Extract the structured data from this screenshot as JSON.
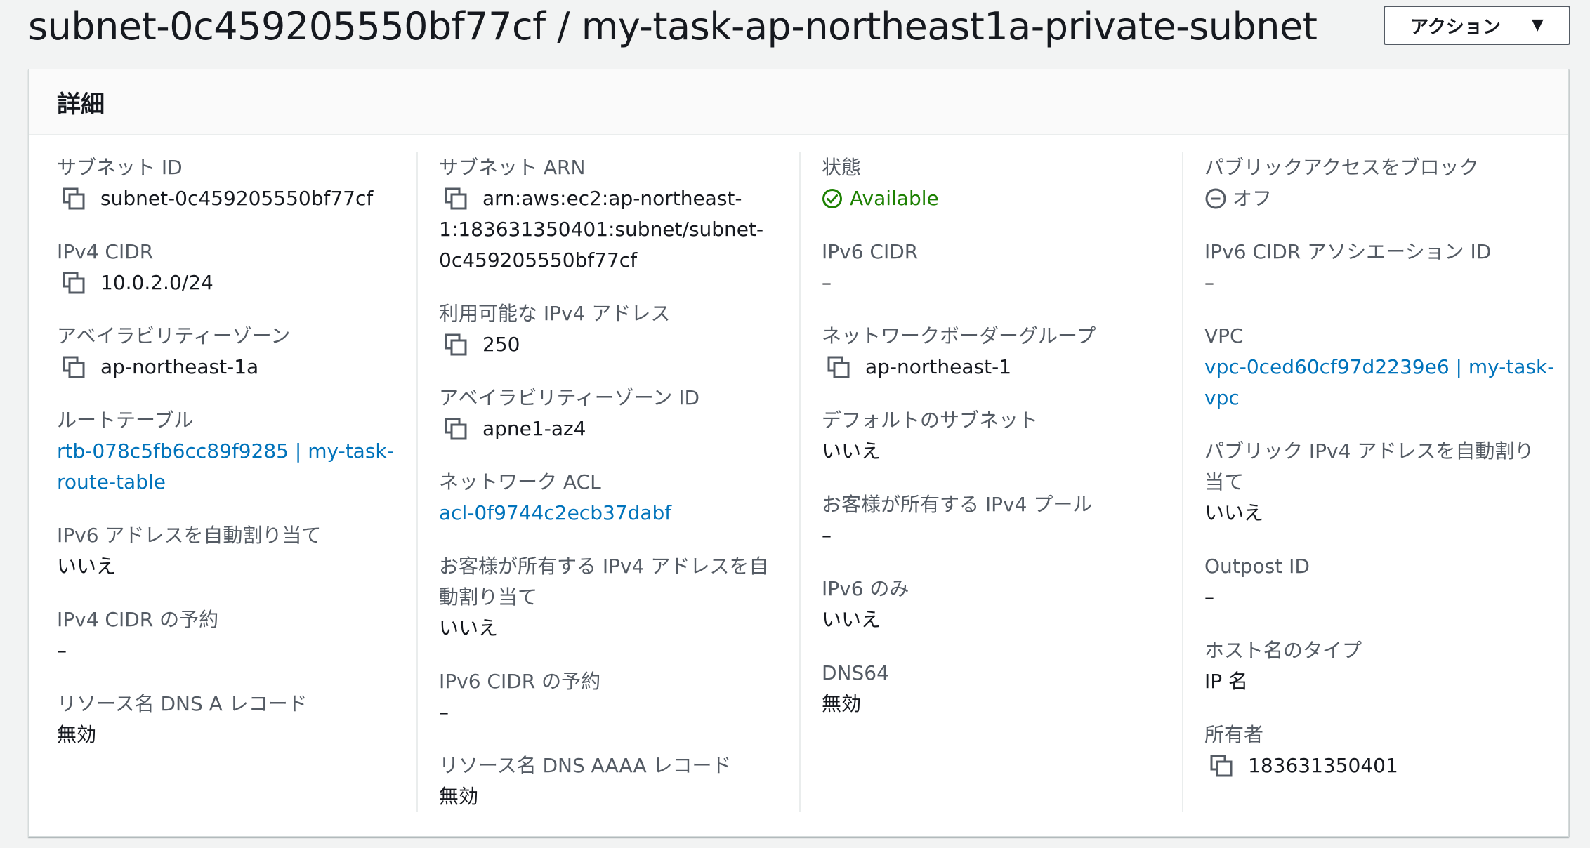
{
  "header": {
    "title": "subnet-0c459205550bf77cf / my-task-ap-northeast1a-private-subnet",
    "action_button": "アクション",
    "action_caret_icon": "caret-down-icon"
  },
  "panel": {
    "title": "詳細"
  },
  "col1": {
    "subnet_id": {
      "label": "サブネット ID",
      "value": "subnet-0c459205550bf77cf"
    },
    "ipv4_cidr": {
      "label": "IPv4 CIDR",
      "value": "10.0.2.0/24"
    },
    "az": {
      "label": "アベイラビリティーゾーン",
      "value": "ap-northeast-1a"
    },
    "route_table": {
      "label": "ルートテーブル",
      "line1": "rtb-078c5fb6cc89f9285 | my-task-",
      "line2": "route-table"
    },
    "ipv6_auto": {
      "label": "IPv6 アドレスを自動割り当て",
      "value": "いいえ"
    },
    "ipv4_reservation": {
      "label": "IPv4 CIDR の予約",
      "value": "–"
    },
    "dns_a": {
      "label": "リソース名 DNS A レコード",
      "value": "無効"
    }
  },
  "col2": {
    "subnet_arn": {
      "label": "サブネット ARN",
      "line1": "arn:aws:ec2:ap-northeast-",
      "line2": "1:183631350401:subnet/subnet-",
      "line3": "0c459205550bf77cf"
    },
    "available_ipv4": {
      "label": "利用可能な IPv4 アドレス",
      "value": "250"
    },
    "az_id": {
      "label": "アベイラビリティーゾーン ID",
      "value": "apne1-az4"
    },
    "network_acl": {
      "label": "ネットワーク ACL",
      "value": "acl-0f9744c2ecb37dabf"
    },
    "customer_owned_auto": {
      "label_line1": "お客様が所有する IPv4 アドレスを自",
      "label_line2": "動割り当て",
      "value": "いいえ"
    },
    "ipv6_reservation": {
      "label": "IPv6 CIDR の予約",
      "value": "–"
    },
    "dns_aaaa": {
      "label": "リソース名 DNS AAAA レコード",
      "value": "無効"
    }
  },
  "col3": {
    "state": {
      "label": "状態",
      "value": "Available",
      "color": "#1d8102"
    },
    "ipv6_cidr": {
      "label": "IPv6 CIDR",
      "value": "–"
    },
    "border_group": {
      "label": "ネットワークボーダーグループ",
      "value": "ap-northeast-1"
    },
    "default_subnet": {
      "label": "デフォルトのサブネット",
      "value": "いいえ"
    },
    "customer_pool": {
      "label": "お客様が所有する IPv4 プール",
      "value": "–"
    },
    "ipv6_only": {
      "label": "IPv6 のみ",
      "value": "いいえ"
    },
    "dns64": {
      "label": "DNS64",
      "value": "無効"
    }
  },
  "col4": {
    "block_public": {
      "label": "パブリックアクセスをブロック",
      "value": "オフ"
    },
    "ipv6_assoc": {
      "label": "IPv6 CIDR アソシエーション ID",
      "value": "–"
    },
    "vpc": {
      "label": "VPC",
      "line1": "vpc-0ced60cf97d2239e6 | my-task-",
      "line2": "vpc"
    },
    "public_ipv4_auto": {
      "label_line1": "パブリック IPv4 アドレスを自動割り",
      "label_line2": "当て",
      "value": "いいえ"
    },
    "outpost": {
      "label": "Outpost ID",
      "value": "–"
    },
    "hostname_type": {
      "label": "ホスト名のタイプ",
      "value": "IP 名"
    },
    "owner": {
      "label": "所有者",
      "value": "183631350401"
    }
  },
  "colors": {
    "link": "#0073bb",
    "label": "#545b64",
    "success": "#1d8102"
  }
}
